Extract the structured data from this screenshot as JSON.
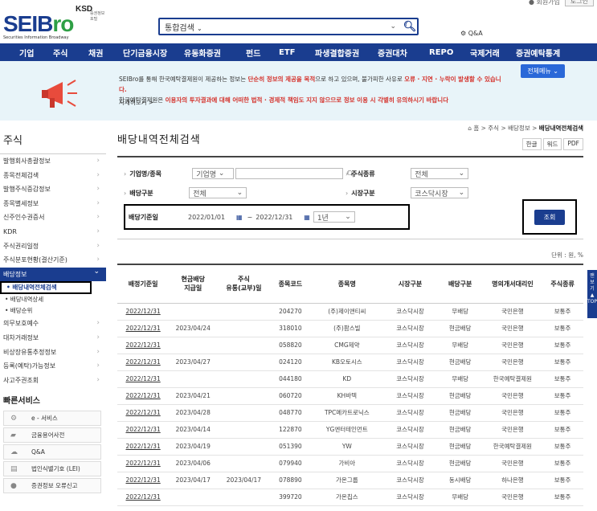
{
  "top_util": {
    "text": "● 회원가입  로그인",
    "login": "로그인"
  },
  "logo": {
    "ksd": "KSD",
    "ksd_sub": "증권정보포털",
    "sei": "SEIB",
    "ro": "ro",
    "sub": "Securities Information Broadway"
  },
  "search": {
    "select": "통합검색",
    "qa": "Q&A"
  },
  "gnb": [
    "기업",
    "주식",
    "채권",
    "단기금융시장",
    "유동화증권",
    "펀드",
    "ETF",
    "파생결합증권",
    "증권대차",
    "REPO",
    "국제거래",
    "증권예탁통계"
  ],
  "notice": {
    "line1a": "SEIBro를 통해 한국예탁결제원이 제공하는 정보는 ",
    "line1b": "단순히 정보의 제공을 목적",
    "line1c": "으로 하고 있으며, 불가피한 사유로 ",
    "line1d": "오류 · 지연 · 누락이 발생할 수 있습니다.",
    "line2a": "한국예탁결제원은 ",
    "line2b": "이용자의 투자결과에 대해 어떠한 법적 · 경제적 책임도 지지 않으므로 정보 이용 시 각별히 유의하시기 바랍니다",
    "more": "자세히보기 >",
    "allmenu": "전체메뉴  ⌄"
  },
  "lnb": {
    "title": "주식",
    "menu_top": [
      "발행회사총괄정보",
      "종목전체검색",
      "발행주식증감정보",
      "종목별세정보",
      "신주인수권증서",
      "KDR",
      "주식권리일정",
      "주식분포현황(결산기준)"
    ],
    "active": "배당정보",
    "sub": [
      "배당내역전체검색",
      "배당내역상세",
      "배당순위"
    ],
    "menu_bottom": [
      "의무보호예수",
      "대차거래정보",
      "비상장유통추정정보",
      "등록(예탁)가능정보",
      "사고주권조회"
    ],
    "quick_title": "빠른서비스",
    "quick": [
      {
        "icon": "⚙",
        "label": "e - 서비스"
      },
      {
        "icon": "▰",
        "label": "금융용어사전"
      },
      {
        "icon": "☁",
        "label": "Q&A"
      },
      {
        "icon": "▤",
        "label": "법인식별기호 (LEI)"
      },
      {
        "icon": "●",
        "label": "증권정보 오류신고"
      }
    ]
  },
  "content": {
    "title": "배당내역전체검색",
    "breadcrumb": "⌂ 홈 > 주식 > 배당정보 > ",
    "breadcrumb_current": "배당내역전체검색",
    "export": [
      "한글",
      "워드",
      "PDF"
    ],
    "form": {
      "company_label": "기업명/종목",
      "company_value": "기업명",
      "stock_type_label": "주식종류",
      "stock_type_value": "전체",
      "div_type_label": "배당구분",
      "div_type_value": "전체",
      "market_label": "시장구분",
      "market_value": "코스닥시장",
      "period_label": "배당기준일",
      "date_from": "2022/01/01",
      "date_to": "2022/12/31",
      "range": "1년",
      "search_btn": "조회"
    },
    "unit": "단위 : 원, %",
    "columns": [
      "배정기준일",
      "현금배당\n지급일",
      "주식\n유통(교부)일",
      "종목코드",
      "종목명",
      "시장구분",
      "배당구분",
      "명의개서대리인",
      "주식종류"
    ],
    "rows": [
      [
        "2022/12/31",
        "",
        "",
        "204270",
        "(주)제이앤티씨",
        "코스닥시장",
        "무배당",
        "국민은행",
        "보통주"
      ],
      [
        "2022/12/31",
        "2023/04/24",
        "",
        "318010",
        "(주)팜스빌",
        "코스닥시장",
        "현금배당",
        "국민은행",
        "보통주"
      ],
      [
        "2022/12/31",
        "",
        "",
        "058820",
        "CMG제약",
        "코스닥시장",
        "무배당",
        "국민은행",
        "보통주"
      ],
      [
        "2022/12/31",
        "2023/04/27",
        "",
        "024120",
        "KB오토시스",
        "코스닥시장",
        "현금배당",
        "국민은행",
        "보통주"
      ],
      [
        "2022/12/31",
        "",
        "",
        "044180",
        "KD",
        "코스닥시장",
        "무배당",
        "한국예탁결제원",
        "보통주"
      ],
      [
        "2022/12/31",
        "2023/04/21",
        "",
        "060720",
        "KH바텍",
        "코스닥시장",
        "현금배당",
        "국민은행",
        "보통주"
      ],
      [
        "2022/12/31",
        "2023/04/28",
        "",
        "048770",
        "TPC메카트로닉스",
        "코스닥시장",
        "현금배당",
        "국민은행",
        "보통주"
      ],
      [
        "2022/12/31",
        "2023/04/14",
        "",
        "122870",
        "YG엔터테인먼트",
        "코스닥시장",
        "현금배당",
        "국민은행",
        "보통주"
      ],
      [
        "2022/12/31",
        "2023/04/19",
        "",
        "051390",
        "YW",
        "코스닥시장",
        "현금배당",
        "한국예탁결제원",
        "보통주"
      ],
      [
        "2022/12/31",
        "2023/04/06",
        "",
        "079940",
        "가비아",
        "코스닥시장",
        "현금배당",
        "국민은행",
        "보통주"
      ],
      [
        "2022/12/31",
        "2023/04/17",
        "2023/04/17",
        "078890",
        "가온그룹",
        "코스닥시장",
        "동시배당",
        "하나은행",
        "보통주"
      ],
      [
        "2022/12/31",
        "",
        "",
        "399720",
        "가온칩스",
        "코스닥시장",
        "무배당",
        "국민은행",
        "보통주"
      ]
    ]
  },
  "float_side": "맨\n보\n기\n▲\nTOP"
}
